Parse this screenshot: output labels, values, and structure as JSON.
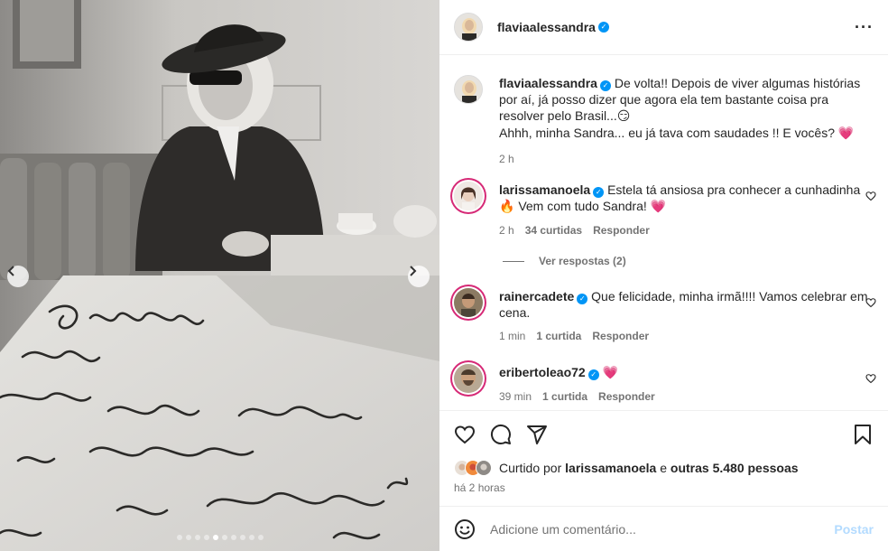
{
  "post": {
    "author": "flaviaalessandra",
    "more_icon": "more-horizontal-icon"
  },
  "photo": {
    "prev_icon": "chevron-left-icon",
    "next_icon": "chevron-right-icon",
    "carousel_dots": 10,
    "active_dot": 4
  },
  "caption": {
    "username": "flaviaalessandra",
    "line1": "De volta!! Depois de viver algumas histórias por aí, já posso dizer que agora ela tem bastante coisa pra resolver pelo Brasil...",
    "line1_emoji": "😏",
    "line2": "Ahhh, minha Sandra... eu já tava com saudades !! E vocês?",
    "line2_emoji": "💗",
    "time": "2 h"
  },
  "comments": [
    {
      "username": "larissamanoela",
      "text": "Estela tá ansiosa pra conhecer a cunhadinha",
      "emoji_mid": "🔥",
      "text2": "Vem com tudo Sandra!",
      "emoji_end": "💗",
      "time": "2 h",
      "likes": "34 curtidas",
      "reply": "Responder"
    },
    {
      "username": "rainercadete",
      "text": "Que felicidade, minha irmã!!!! Vamos celebrar em cena.",
      "time": "1 min",
      "likes": "1 curtida",
      "reply": "Responder"
    },
    {
      "username": "eribertoleao72",
      "emoji": "💗",
      "time": "39 min",
      "likes": "1 curtida",
      "reply": "Responder"
    }
  ],
  "view_replies": "Ver respostas (2)",
  "likes_summary": {
    "prefix": "Curtido por",
    "user": "larissamanoela",
    "joiner": "e",
    "others": "outras 5.480 pessoas"
  },
  "posted_time": "há 2 horas",
  "comment_box": {
    "placeholder": "Adicione um comentário...",
    "post_label": "Postar"
  },
  "colors": {
    "verified": "#0095f6",
    "meta_text": "#737373",
    "post_disabled": "#b3dbff",
    "heart_pink": "#e83e6c"
  }
}
